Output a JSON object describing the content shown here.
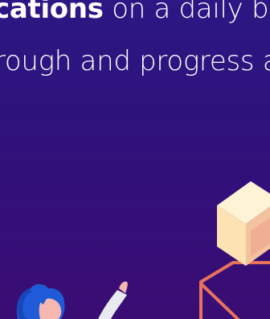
{
  "headline": {
    "line1_bold": "cations",
    "line1_rest": " on a daily bas",
    "line2": "rough and progress a"
  },
  "colors": {
    "background_top": "#2c1784",
    "background_bottom": "#3a0d74",
    "cube_light": "#fde7bc",
    "cube_shadow": "#e8b98d",
    "frame_line": "#e8735c",
    "hair": "#1f5bd8",
    "skin": "#f6b7b0",
    "sleeve": "#e9e9f2"
  },
  "icons": [
    "cube-illustration",
    "wire-frame-illustration",
    "person-illustration"
  ]
}
